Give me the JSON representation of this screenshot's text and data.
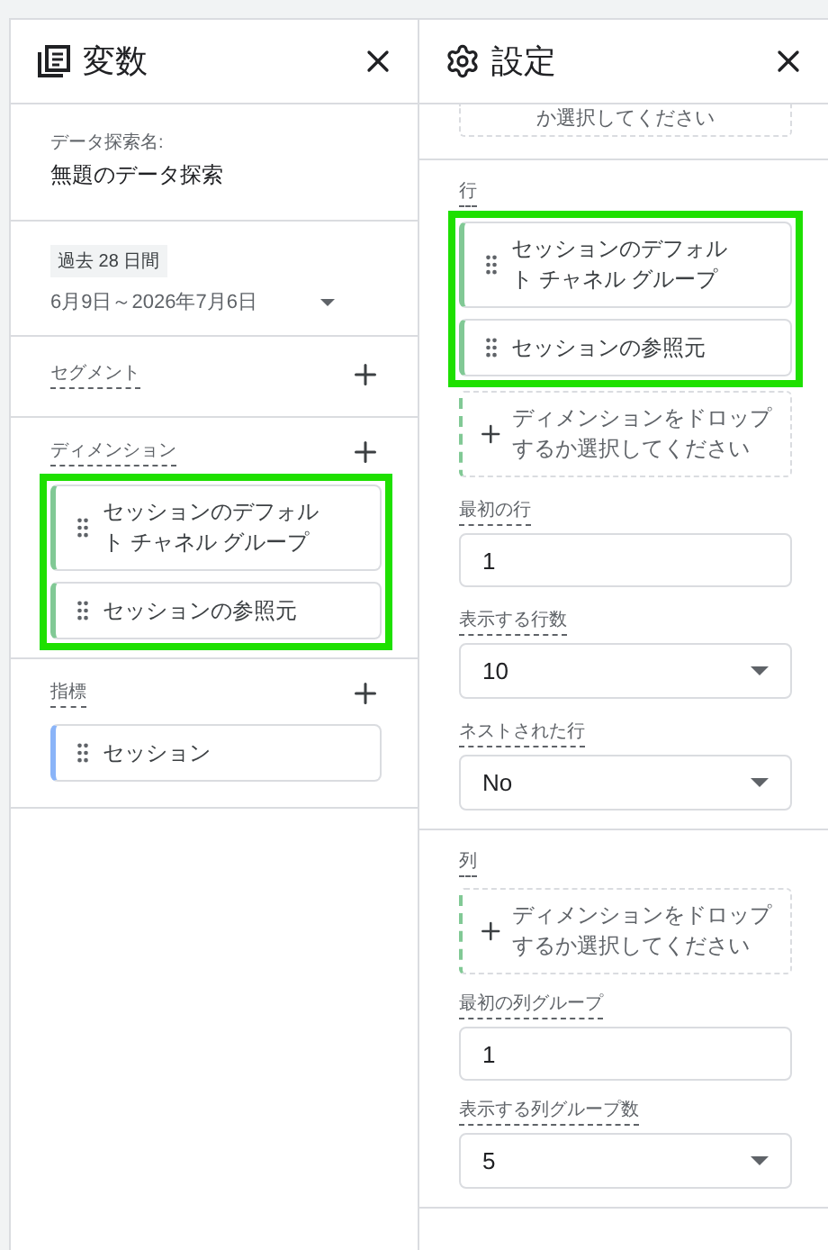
{
  "variables": {
    "title": "変数",
    "exploration_name": {
      "label": "データ探索名:",
      "value": "無題のデータ探索"
    },
    "date_range": {
      "badge": "過去 28 日間",
      "range": "6月9日～2026年7月6日"
    },
    "segments": {
      "label": "セグメント"
    },
    "dimensions": {
      "label": "ディメンション",
      "highlighted": true,
      "items": [
        {
          "label": "セッションのデフォルト チャネル グループ"
        },
        {
          "label": "セッションの参照元"
        }
      ]
    },
    "metrics": {
      "label": "指標",
      "items": [
        {
          "label": "セッション"
        }
      ]
    }
  },
  "settings": {
    "title": "設定",
    "top_dropzone": {
      "text": "か選択してください"
    },
    "rows": {
      "label": "行",
      "highlighted": true,
      "items": [
        {
          "label": "セッションのデフォルト チャネル グループ"
        },
        {
          "label": "セッションの参照元"
        }
      ],
      "dropzone": {
        "text": "ディメンションをドロップするか選択してください"
      },
      "fields": [
        {
          "kind": "input",
          "label": "最初の行",
          "value": "1"
        },
        {
          "kind": "select",
          "label": "表示する行数",
          "value": "10"
        },
        {
          "kind": "select",
          "label": "ネストされた行",
          "value": "No"
        }
      ]
    },
    "columns": {
      "label": "列",
      "dropzone": {
        "text": "ディメンションをドロップするか選択してください"
      },
      "fields": [
        {
          "kind": "input",
          "label": "最初の列グループ",
          "value": "1"
        },
        {
          "kind": "select",
          "label": "表示する列グループ数",
          "value": "5"
        }
      ]
    }
  }
}
